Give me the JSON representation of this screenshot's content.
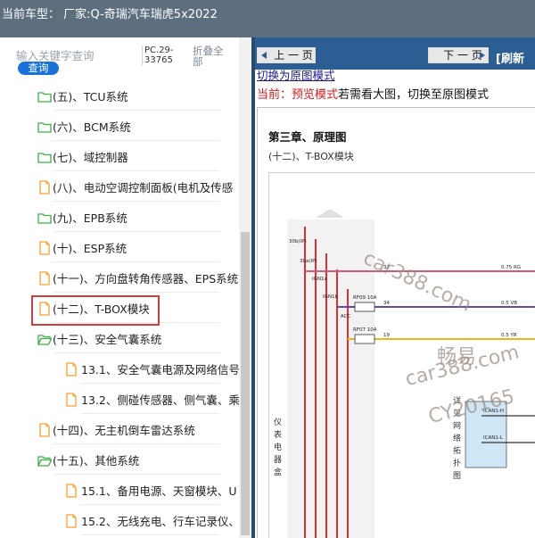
{
  "titlebar": {
    "text": "当前车型：  厂家:Q-奇瑞汽车瑞虎5x2022"
  },
  "sidebar": {
    "search_placeholder": "输入关键字查询",
    "search_button": "查询",
    "pc_number": "PC.29-33765",
    "collapse_label": "折叠全部",
    "items": [
      {
        "label": "(五)、TCU系统",
        "icon": "folder-icon",
        "color": "#3cb043"
      },
      {
        "label": "(六)、BCM系统",
        "icon": "folder-icon",
        "color": "#3cb043"
      },
      {
        "label": "(七)、域控制器",
        "icon": "folder-icon",
        "color": "#3cb043"
      },
      {
        "label": "(八)、电动空调控制面板(电机及传感",
        "icon": "document-icon",
        "color": "#f0a030"
      },
      {
        "label": "(九)、EPB系统",
        "icon": "folder-icon",
        "color": "#3cb043"
      },
      {
        "label": "(十)、ESP系统",
        "icon": "document-icon",
        "color": "#f0a030"
      },
      {
        "label": "(十一)、方向盘转角传感器、EPS系统",
        "icon": "document-icon",
        "color": "#f0a030"
      },
      {
        "label": "(十二)、T-BOX模块",
        "icon": "document-icon",
        "color": "#f0a030",
        "selected": true
      },
      {
        "label": "(十三)、安全气囊系统",
        "icon": "folder-open-icon",
        "color": "#3cb043"
      },
      {
        "label": "13.1、安全气囊电源及网络信号",
        "icon": "document-icon",
        "color": "#f0a030"
      },
      {
        "label": "13.2、侧碰传感器、侧气囊、乘",
        "icon": "document-icon",
        "color": "#f0a030"
      },
      {
        "label": "(十四)、无主机倒车雷达系统",
        "icon": "document-icon",
        "color": "#f0a030"
      },
      {
        "label": "(十五)、其他系统",
        "icon": "folder-open-icon",
        "color": "#3cb043"
      },
      {
        "label": "15.1、备用电源、天窗模块、U",
        "icon": "document-icon",
        "color": "#f0a030"
      },
      {
        "label": "15.2、无线充电、行车记录仪、",
        "icon": "document-icon",
        "color": "#f0a030"
      }
    ]
  },
  "viewer": {
    "prev_button": "上 一 页",
    "next_button": "下 一 页",
    "refresh_label": "[刷新",
    "switch_link": "切换为原图模式",
    "status_prefix": "当前：预览模式",
    "status_suffix": "若需看大图，切换至原图模式",
    "chapter_title": "第三章、原理图",
    "section_title": "(十二)、T-BOX模块"
  },
  "diagram": {
    "pins": [
      "30b(IP)",
      "30a(IP)",
      "IGN1a",
      "IGN1b",
      "ACC"
    ],
    "fuses": [
      "RF09 10A",
      "RF07 10A"
    ],
    "wires": [
      {
        "num": "32",
        "spec": "0.75 RG",
        "color": "#d25a7a"
      },
      {
        "num": "34",
        "spec": "0.5 VB",
        "color": "#6a4aa0"
      },
      {
        "num": "19",
        "spec": "0.5 YR",
        "color": "#e8b820"
      }
    ],
    "side_label": "仪表电器盒",
    "network_label": "详见网络拓扑图",
    "can_high": "ICAN1-H",
    "can_low": "ICAN1-L"
  },
  "watermarks": {
    "w1": "car388.com",
    "w2": "畅易",
    "w3": "car388.com",
    "w4": "CY20165"
  }
}
